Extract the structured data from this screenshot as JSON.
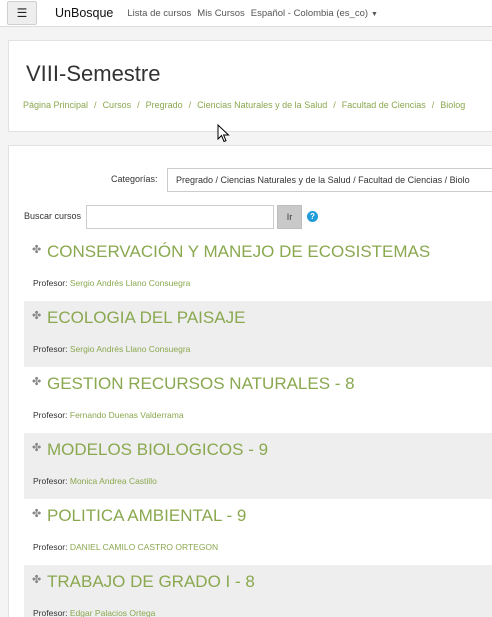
{
  "navbar": {
    "menu_icon": "hamburger-icon",
    "brand": "UnBosque",
    "links": [
      "Lista de cursos",
      "Mis Cursos"
    ],
    "language": "Español - Colombia ‎(es_co)‎"
  },
  "header": {
    "title": "VIII-Semestre",
    "breadcrumb": [
      "Página Principal",
      "Cursos",
      "Pregrado",
      "Ciencias Naturales y de la Salud",
      "Facultad de Ciencias",
      "Biolog"
    ]
  },
  "filters": {
    "category_label": "Categorías:",
    "category_value": "Pregrado / Ciencias Naturales y de la Salud / Facultad de Ciencias / Biolo",
    "search_label": "Buscar cursos",
    "search_value": "",
    "search_button": "Ir"
  },
  "courses": [
    {
      "name": "CONSERVACIÓN Y MANEJO DE ECOSISTEMAS",
      "teacher_label": "Profesor:",
      "teacher": "Sergio Andrés Llano Consuegra"
    },
    {
      "name": "ECOLOGIA DEL PAISAJE",
      "teacher_label": "Profesor:",
      "teacher": "Sergio Andrés Llano Consuegra"
    },
    {
      "name": "GESTION RECURSOS NATURALES - 8",
      "teacher_label": "Profesor:",
      "teacher": "Fernando Duenas Valderrama"
    },
    {
      "name": "MODELOS BIOLOGICOS - 9",
      "teacher_label": "Profesor:",
      "teacher": "Monica Andrea Castillo"
    },
    {
      "name": "POLITICA AMBIENTAL - 9",
      "teacher_label": "Profesor:",
      "teacher": "DANIEL CAMILO CASTRO ORTEGON"
    },
    {
      "name": "TRABAJO DE GRADO I - 8",
      "teacher_label": "Profesor:",
      "teacher": "Edgar Palacios Ortega"
    }
  ],
  "colors": {
    "accent": "#8aa84f",
    "alt_row": "#eeeeee",
    "help": "#1f9bd8"
  }
}
